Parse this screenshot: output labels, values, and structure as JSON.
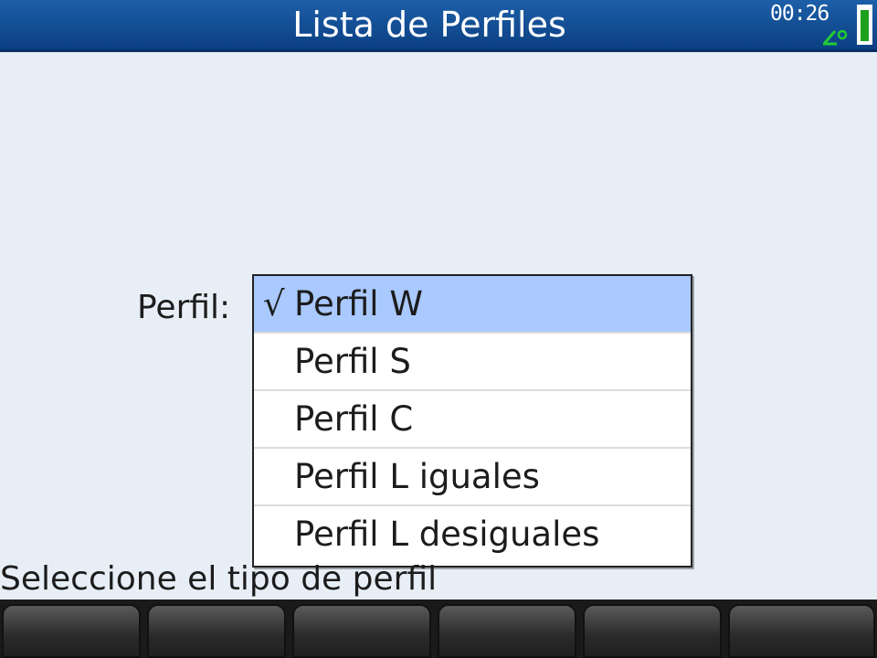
{
  "header": {
    "title": "Lista de Perfiles",
    "clock": "00:26",
    "angle_icon": "angle-degree-icon",
    "battery_icon": "battery-icon"
  },
  "form": {
    "label": "Perfil:",
    "check_mark": "√",
    "options": [
      {
        "label": "Perfil W",
        "selected": true
      },
      {
        "label": "Perfil S",
        "selected": false
      },
      {
        "label": "Perfil C",
        "selected": false
      },
      {
        "label": "Perfil L iguales",
        "selected": false
      },
      {
        "label": "Perfil L desiguales",
        "selected": false
      }
    ]
  },
  "status_text": "Seleccione el tipo de perfil",
  "softkeys": [
    "",
    "",
    "",
    "",
    "",
    ""
  ],
  "colors": {
    "header": "#0b3f82",
    "selected_row": "#a9c9ff",
    "background": "#e7eef5",
    "battery": "#1ea01e",
    "angle_icon": "#22cc33"
  }
}
